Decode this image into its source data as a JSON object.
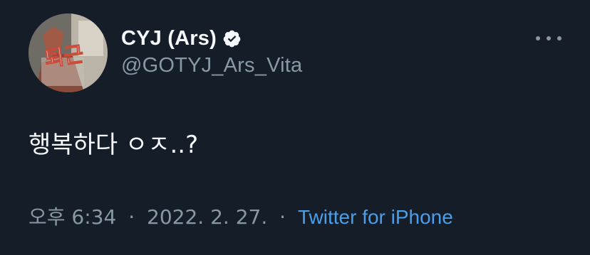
{
  "author": {
    "display_name": "CYJ (Ars)",
    "handle": "@GOTYJ_Ars_Vita",
    "verified": true,
    "avatar_text": "퇴근"
  },
  "tweet": {
    "text": "행복하다 ㅇㅈ..?",
    "time": "오후 6:34",
    "date": "2022. 2. 27.",
    "separator": "·",
    "source": "Twitter for iPhone"
  },
  "icons": {
    "verified": "verified-badge-icon",
    "more": "more-options-icon"
  },
  "colors": {
    "background": "#151d28",
    "primary_text": "#f5f8fa",
    "secondary_text": "#8899a6",
    "link": "#4a9eeb"
  }
}
